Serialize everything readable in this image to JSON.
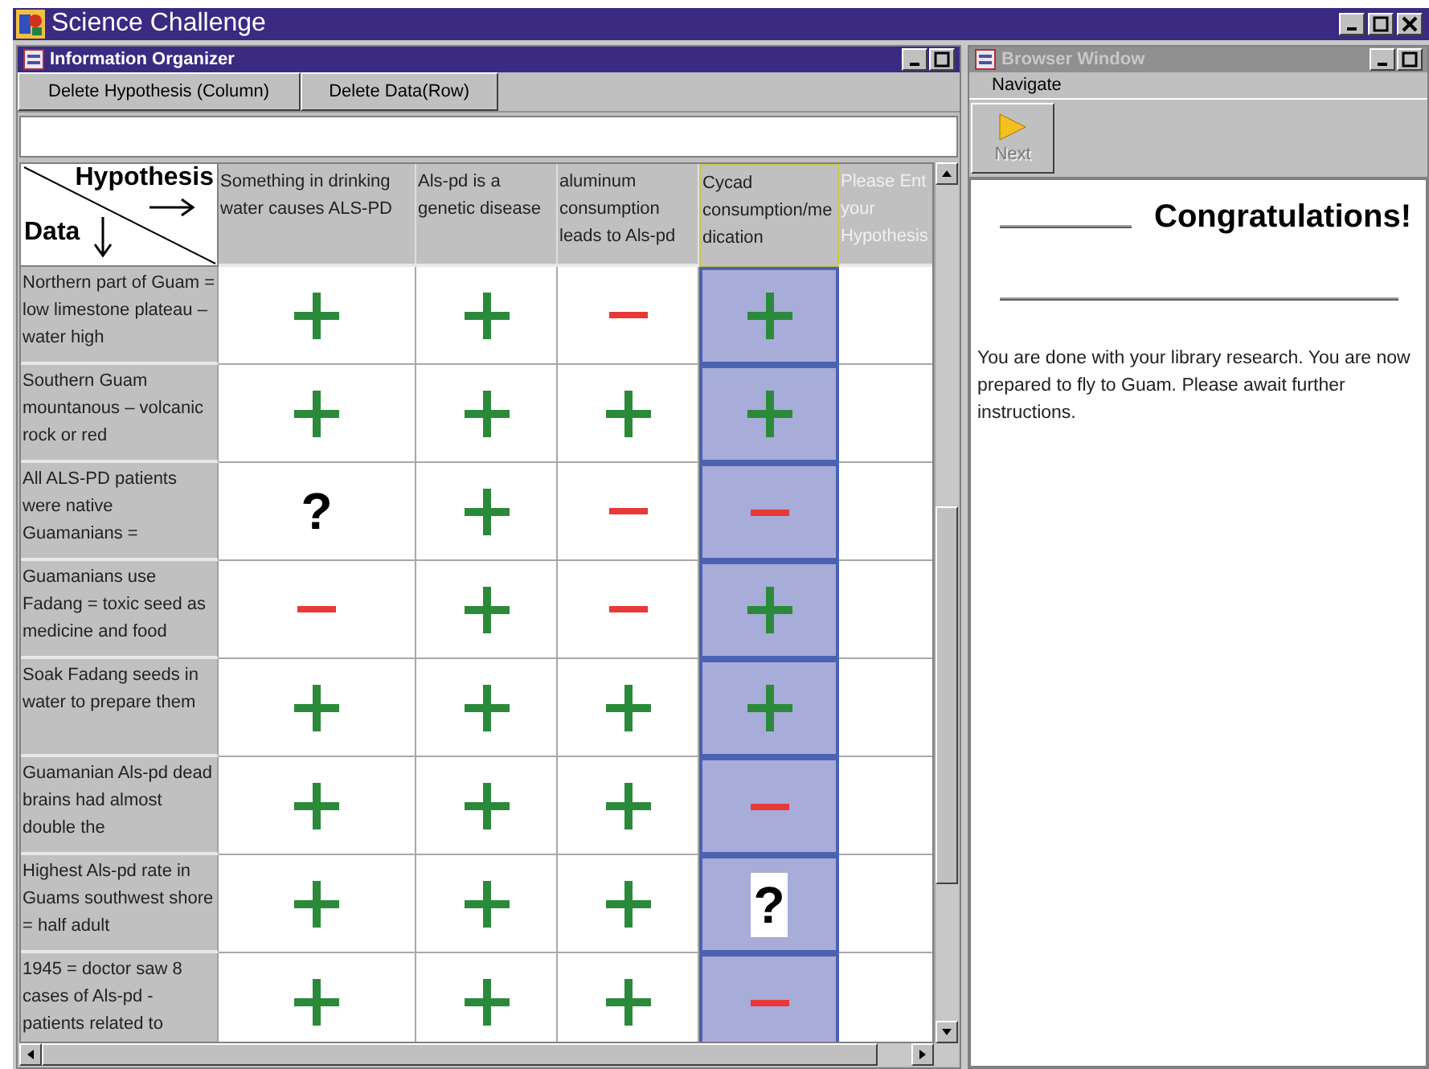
{
  "app": {
    "title": "Science Challenge"
  },
  "organizer": {
    "title": "Information Organizer",
    "active": true,
    "buttons": [
      "Delete Hypothesis (Column)",
      "Delete Data(Row)"
    ]
  },
  "corner": {
    "column_label": "Hypothesis",
    "row_label": "Data"
  },
  "hypotheses": [
    {
      "kind": "entry",
      "text": "Something in drinking water causes ALS-PD",
      "selected": false
    },
    {
      "kind": "entry",
      "text": "Als-pd is a genetic disease",
      "selected": false
    },
    {
      "kind": "entry",
      "text": "aluminum consumption leads to Als-pd",
      "selected": false
    },
    {
      "kind": "entry",
      "text": "Cycad consumption/medication",
      "selected": true
    },
    {
      "kind": "prompt",
      "text": "Please Ent your Hypothesis",
      "selected": false
    }
  ],
  "rows": [
    {
      "label": "Northern part of Guam = low limestone plateau – water high",
      "cells": [
        {
          "kind": "plus"
        },
        {
          "kind": "plus"
        },
        {
          "kind": "minus"
        },
        {
          "kind": "plus"
        }
      ]
    },
    {
      "label": "Southern Guam mountanous – volcanic rock or red",
      "cells": [
        {
          "kind": "plus"
        },
        {
          "kind": "plus"
        },
        {
          "kind": "plus"
        },
        {
          "kind": "plus"
        }
      ]
    },
    {
      "label": "All ALS-PD patients were native Guamanians =",
      "cells": [
        {
          "kind": "question",
          "text": "?"
        },
        {
          "kind": "plus"
        },
        {
          "kind": "minus"
        },
        {
          "kind": "minus"
        }
      ]
    },
    {
      "label": "Guamanians use Fadang = toxic seed as medicine and food",
      "cells": [
        {
          "kind": "minus"
        },
        {
          "kind": "plus"
        },
        {
          "kind": "minus"
        },
        {
          "kind": "plus"
        }
      ]
    },
    {
      "label": "Soak Fadang seeds in water to prepare them",
      "cells": [
        {
          "kind": "plus"
        },
        {
          "kind": "plus"
        },
        {
          "kind": "plus"
        },
        {
          "kind": "plus"
        }
      ]
    },
    {
      "label": "Guamanian Als-pd dead brains had almost double the",
      "cells": [
        {
          "kind": "plus"
        },
        {
          "kind": "plus"
        },
        {
          "kind": "plus"
        },
        {
          "kind": "minus"
        }
      ]
    },
    {
      "label": "Highest Als-pd rate in Guams southwest shore = half adult",
      "cells": [
        {
          "kind": "plus"
        },
        {
          "kind": "plus"
        },
        {
          "kind": "plus"
        },
        {
          "kind": "question",
          "text": "?"
        }
      ]
    },
    {
      "label": "1945 = doctor saw 8 cases of Als-pd  - patients related to",
      "cells": [
        {
          "kind": "plus"
        },
        {
          "kind": "plus"
        },
        {
          "kind": "plus"
        },
        {
          "kind": "minus"
        }
      ]
    }
  ],
  "browser": {
    "title": "Browser Window",
    "active": false,
    "menu": [
      "Navigate"
    ],
    "next_button": {
      "label": "Next",
      "disabled": true
    },
    "heading": "Congratulations!",
    "message": "You are done with your library research. You are now prepared to fly to Guam. Please await further instructions."
  }
}
